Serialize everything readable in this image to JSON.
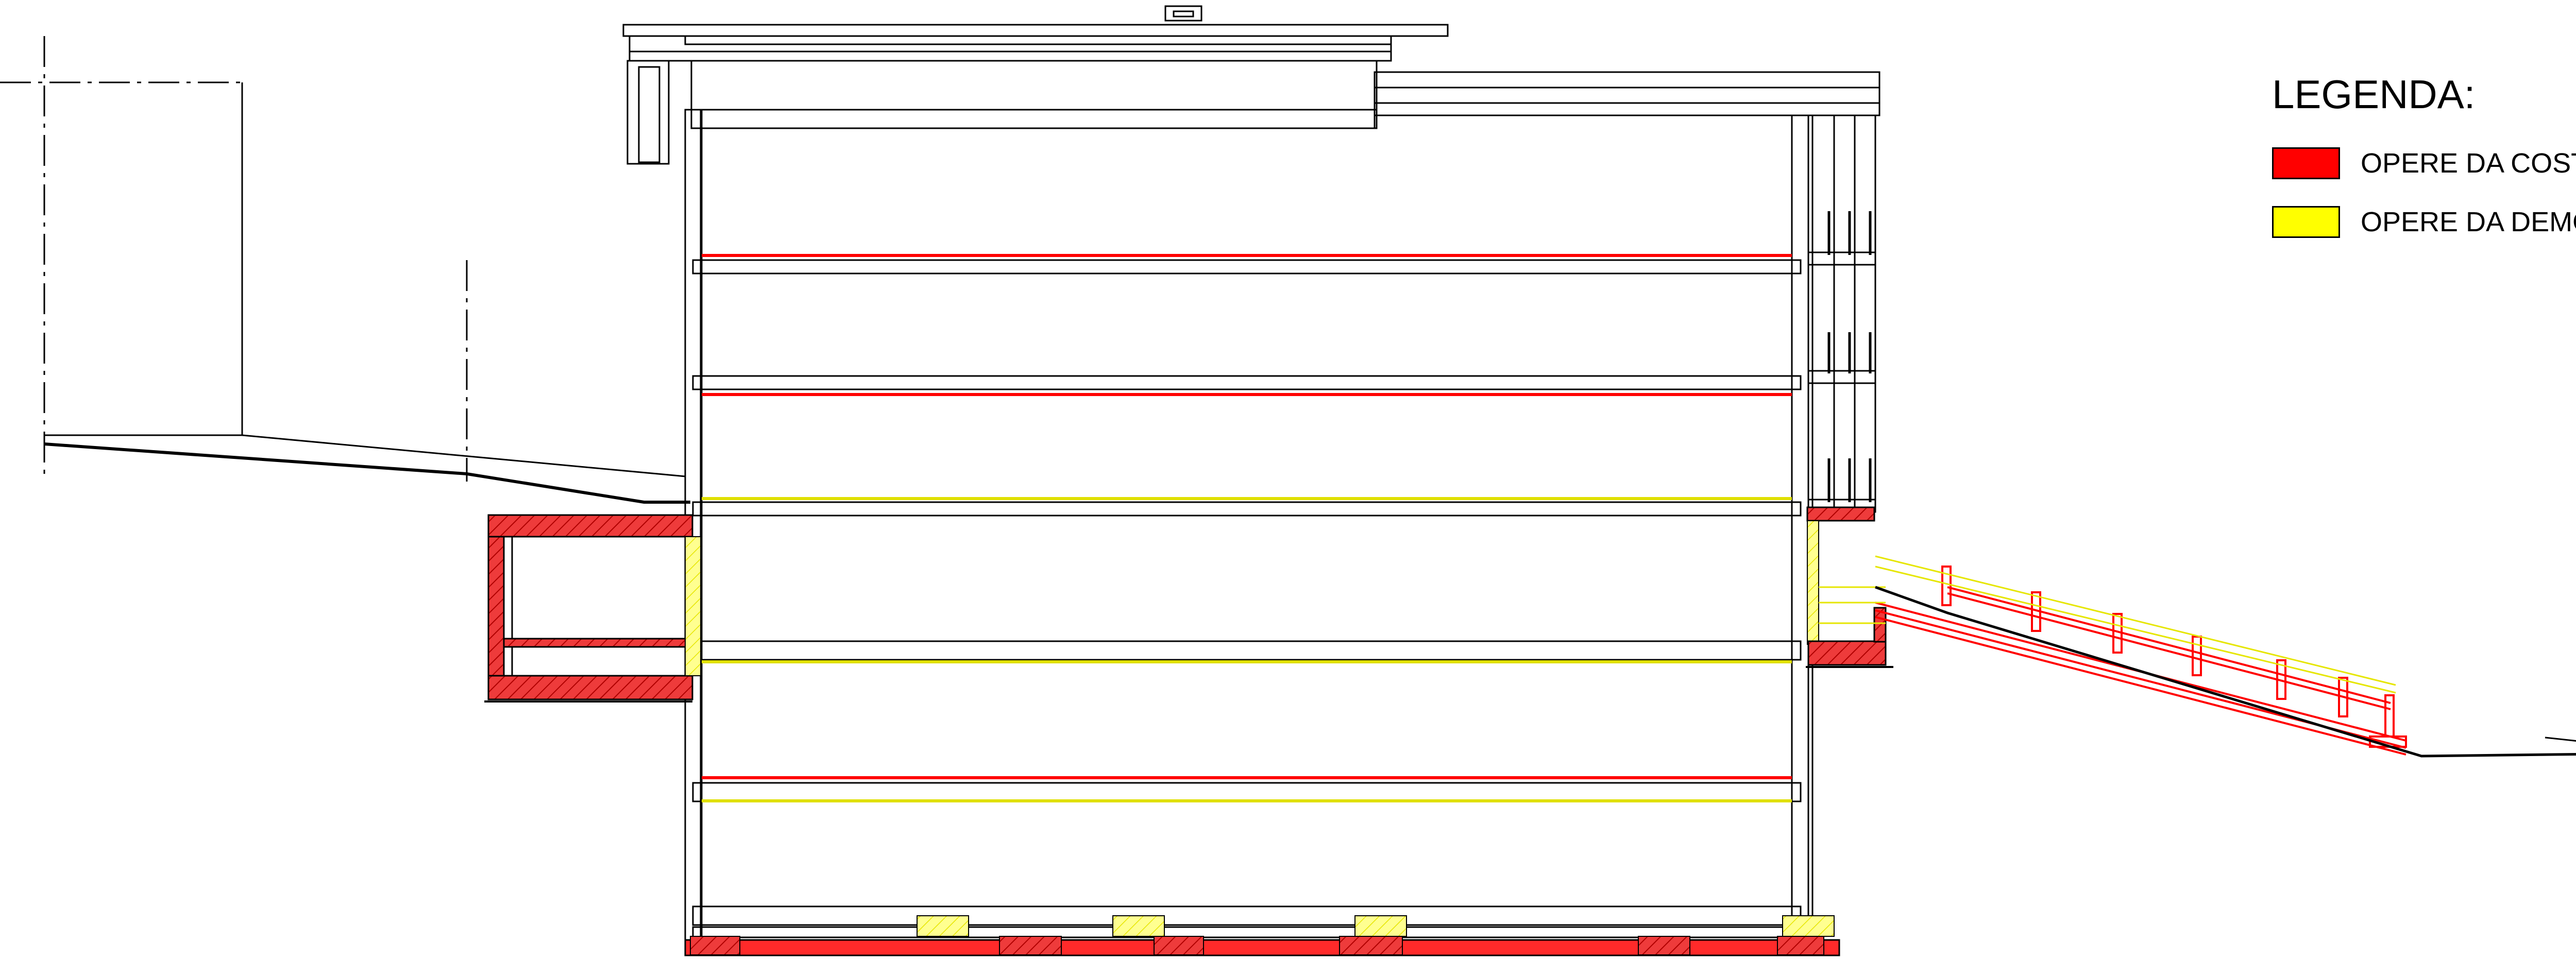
{
  "legend": {
    "title": "LEGENDA:",
    "items": [
      {
        "label": "OPERE DA COSTRUIRE",
        "color": "#ff0000"
      },
      {
        "label": "OPERE DA DEMOLIRE",
        "color": "#ffff00"
      }
    ]
  },
  "colors": {
    "line": "#000000",
    "construct": "#ff0000",
    "construct_fill": "#f04040",
    "demolish": "#ffff00",
    "demolish_fill": "#ffff80"
  }
}
